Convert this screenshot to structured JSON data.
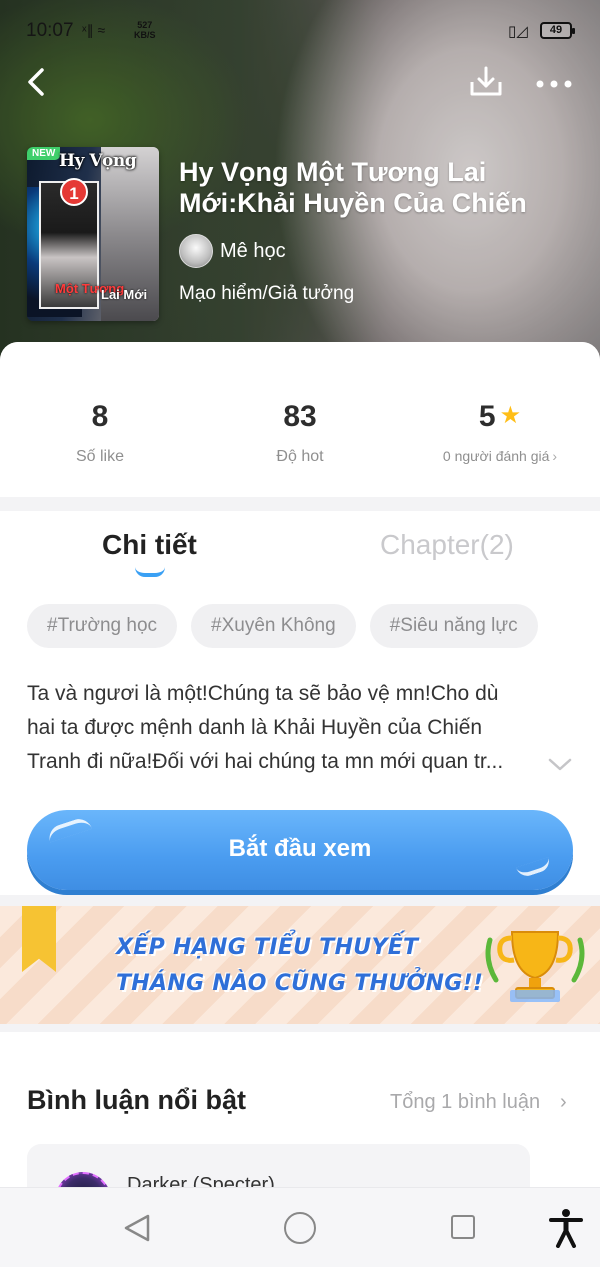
{
  "status_bar": {
    "time": "10:07",
    "net_speed_value": "527",
    "net_speed_unit": "KB/S",
    "battery": "49"
  },
  "nav": {
    "back_icon": "chevron-left-icon",
    "download_icon": "download-icon",
    "more_icon": "more-dots-icon"
  },
  "cover": {
    "new_badge": "NEW",
    "rank_badge": "1",
    "title_top": "Hy Vọng",
    "title_mid": "Một Tương",
    "title_right": "Lai Mới"
  },
  "novel": {
    "title": "Hy Vọng Một Tương Lai Mới:Khải Huyền Của Chiến",
    "author": "Mê học",
    "genre": "Mạo hiểm/Giả tưởng"
  },
  "stats": {
    "likes_value": "8",
    "likes_label": "Số like",
    "hot_value": "83",
    "hot_label": "Độ hot",
    "rating_value": "5",
    "rating_label": "0 người đánh giá",
    "rating_arrow": "›"
  },
  "tabs": {
    "detail": "Chi tiết",
    "chapter": "Chapter(2)"
  },
  "tags": [
    "#Trường học",
    "#Xuyên Không",
    "#Siêu năng lực"
  ],
  "description": {
    "line1": "Ta và ngươi là một!Chúng ta sẽ bảo vệ mn!Cho dù",
    "line2": "hai ta được mệnh danh là Khải Huyền của Chiến",
    "line3": "Tranh đi nữa!Đối với hai chúng ta mn mới quan tr..."
  },
  "start_button": "Bắt đầu xem",
  "banner": {
    "line1": "XẾP HẠNG TIỂU THUYẾT",
    "line2": "THÁNG NÀO CŨNG THƯỞNG!!"
  },
  "comments": {
    "title": "Bình luận nổi bật",
    "total": "Tổng 1 bình luận",
    "arrow": "›",
    "first_user": "Darker (Specter)"
  },
  "colors": {
    "accent_blue": "#4a9cf0",
    "star_yellow": "#ffbe17",
    "tab_inactive": "#c9c9cc"
  }
}
